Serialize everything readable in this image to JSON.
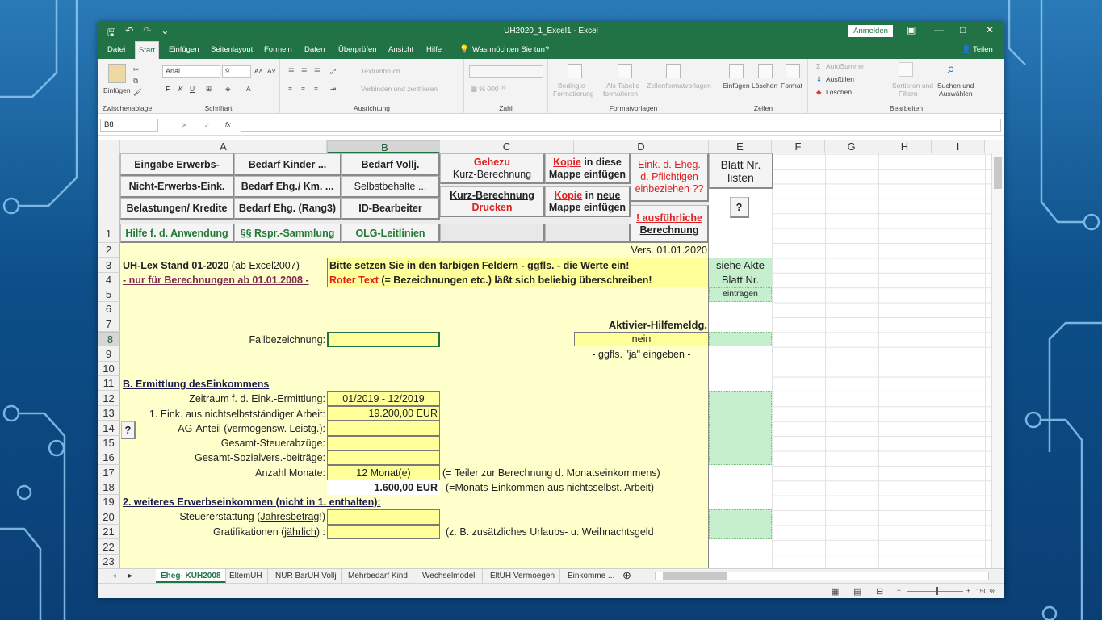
{
  "window": {
    "title": "UH2020_1_Excel1  -  Excel",
    "signin": "Anmelden",
    "share": "Teilen"
  },
  "tabs": [
    "Datei",
    "Start",
    "Einfügen",
    "Seitenlayout",
    "Formeln",
    "Daten",
    "Überprüfen",
    "Ansicht",
    "Hilfe"
  ],
  "tellme": "Was möchten Sie tun?",
  "ribbon": {
    "clipboard": {
      "paste": "Einfügen",
      "label": "Zwischenablage"
    },
    "font": {
      "name": "Arial",
      "size": "9",
      "bold": "F",
      "italic": "K",
      "underline": "U",
      "label": "Schriftart"
    },
    "align": {
      "wrap": "Textumbruch",
      "merge": "Verbinden und zentrieren",
      "label": "Ausrichtung"
    },
    "number": {
      "label": "Zahl"
    },
    "styles": {
      "cond": "Bedingte",
      "cond2": "Formatierung",
      "table": "Als Tabelle",
      "table2": "formatieren",
      "cell": "Zellenformatvorlagen",
      "label": "Formatvorlagen"
    },
    "cells": {
      "insert": "Einfügen",
      "delete": "Löschen",
      "format": "Format",
      "label": "Zellen"
    },
    "edit": {
      "autosum": "AutoSumme",
      "fill": "Ausfüllen",
      "clear": "Löschen",
      "sort": "Sortieren und",
      "sort2": "Filtern",
      "find": "Suchen und",
      "find2": "Auswählen",
      "label": "Bearbeiten"
    }
  },
  "namebox": "B8",
  "columns": [
    "A",
    "B",
    "C",
    "D",
    "E",
    "F",
    "G",
    "H",
    "I"
  ],
  "rows": [
    "1",
    "2",
    "3",
    "4",
    "5",
    "6",
    "7",
    "8",
    "9",
    "10",
    "11",
    "12",
    "13",
    "14",
    "15",
    "16",
    "17",
    "18",
    "19",
    "20",
    "21",
    "22",
    "23"
  ],
  "buttons": {
    "eingabe": "Eingabe Erwerbs-",
    "nichterwerb": "Nicht-Erwerbs-Eink.",
    "belastungen": "Belastungen/ Kredite",
    "hilfe": "Hilfe f. d. Anwendung",
    "bedarfKinder": "Bedarf Kinder ...",
    "bedarfEheg": "Bedarf  Ehg./ Km. ...",
    "bedarfRang": "Bedarf Ehg. (Rang3)",
    "rspr": "§§  Rspr.-Sammlung",
    "bedarfVollj": "Bedarf Vollj.",
    "selbst": "Selbstbehalte ...",
    "idbearb": "ID-Bearbeiter",
    "olg": "OLG-Leitlinien",
    "gehezu": "Gehezu",
    "kurzber": "Kurz-Berechnung",
    "kurzdruck1": "Kurz-Berechnung",
    "kurzdruck2": "Drucken",
    "kopie1a": "Kopie",
    "kopie1b": "in diese",
    "kopie1c": "Mappe einfügen",
    "kopie2a": "Kopie",
    "kopie2b": "in",
    "kopie2c": "neue",
    "kopie2d": "Mappe",
    "kopie2e": "einfügen",
    "eink1": "Eink. d. Eheg.",
    "eink2": "d. Pflichtigen",
    "eink3": "einbeziehen ??",
    "ausf1": "! ausführliche",
    "ausf2": "Berechnung",
    "blatt1": "Blatt Nr.",
    "blatt2": "listen",
    "q": "?"
  },
  "sheet": {
    "vers": "Vers. 01.01.2020",
    "uhlex": "UH-Lex Stand 01-2020",
    "uhlex2": "(ab Excel2007)",
    "nurfuer": "- nur für Berechnungen ab 01.01.2008 -",
    "bitte": "Bitte setzen Sie in den farbigen Feldern - ggfls. - die Werte ein!",
    "roter": "Roter Text",
    "roter2": "(= Bezeichnungen etc.) läßt sich beliebig überschreiben!",
    "sieheAkte": "siehe Akte",
    "blattNr": "Blatt Nr.",
    "eintragen": "eintragen",
    "aktivier": "Aktivier-Hilfemeldg.",
    "fall": "Fallbezeichnung:",
    "nein": "nein",
    "ggfls": "- ggfls. \"ja\" eingeben -",
    "sectionB": "B. Ermittlung desEinkommens",
    "zeitraum": "Zeitraum f. d. Eink.-Ermittlung:",
    "zeitraumVal": "01/2019 - 12/2019",
    "eink": "1. Eink. aus nichtselbstständiger Arbeit:",
    "einkVal": "19.200,00 EUR",
    "ag": "AG-Anteil (vermögensw. Leistg.):",
    "steuer": "Gesamt-Steuerabzüge:",
    "sozial": "Gesamt-Sozialvers.-beiträge:",
    "monate": "Anzahl Monate:",
    "monateVal": "12 Monat(e)",
    "teiler": "(= Teiler zur Berechnung d. Monatseinkommens)",
    "monatsVal": "1.600,00 EUR",
    "monatsNote": "(=Monats-Einkommen aus nichtsselbst. Arbeit)",
    "weiteres": "2. weiteres Erwerbseinkommen (nicht in 1. enthalten):",
    "erstattung1": "Steuererstattung (",
    "erstattung2": "Jahresbetrag",
    "erstattung3": "!)",
    "grati1": "Gratifikationen (",
    "grati2": "jährlich",
    "grati3": ") :",
    "gratiNote": "(z. B. zusätzliches Urlaubs- u. Weihnachtsgeld"
  },
  "sheetTabs": [
    "Eheg- KUH2008",
    "ElternUH",
    "NUR BarUH Vollj",
    "Mehrbedarf Kind",
    "Wechselmodell",
    "EltUH Vermoegen",
    "Einkomme ..."
  ],
  "status": {
    "zoom": "150 %"
  }
}
